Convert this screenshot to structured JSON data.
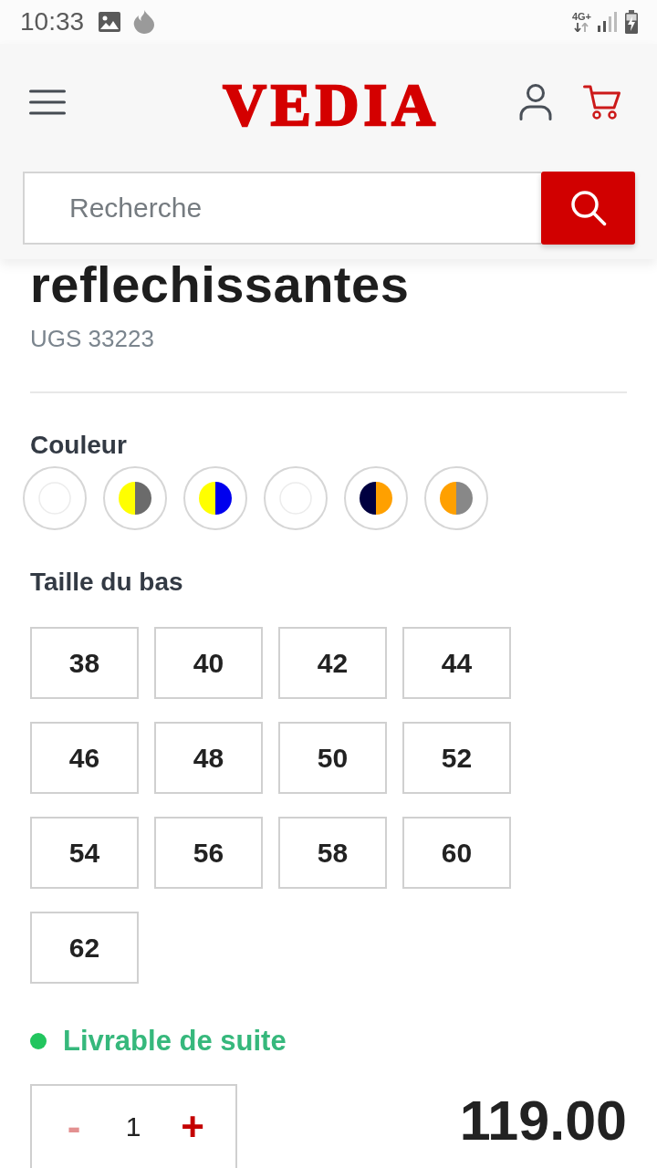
{
  "status_bar": {
    "time": "10:33",
    "network": "4G+"
  },
  "header": {
    "logo": "VEDIA",
    "search": {
      "placeholder": "Recherche"
    }
  },
  "product": {
    "title": "reflechissantes",
    "sku": "UGS 33223"
  },
  "color_option": {
    "label": "Couleur",
    "swatches": [
      {
        "tones": [
          {
            "color": "#ffffff"
          }
        ],
        "selected": false
      },
      {
        "tones": [
          {
            "color": "#ffff00"
          },
          {
            "color": "#6b6b6b"
          }
        ],
        "selected": false
      },
      {
        "tones": [
          {
            "color": "#ffff00"
          },
          {
            "color": "#0000ee"
          }
        ],
        "selected": false
      },
      {
        "tones": [
          {
            "color": "#ffffff"
          }
        ],
        "selected": false
      },
      {
        "tones": [
          {
            "color": "#000040"
          },
          {
            "color": "#ffa000"
          }
        ],
        "selected": false
      },
      {
        "tones": [
          {
            "color": "#ffa000"
          },
          {
            "color": "#888888"
          }
        ],
        "selected": false
      }
    ]
  },
  "size_option": {
    "label": "Taille du bas",
    "sizes": [
      {
        "label": "38",
        "selected": false
      },
      {
        "label": "40",
        "selected": false
      },
      {
        "label": "42",
        "selected": false
      },
      {
        "label": "44",
        "selected": false
      },
      {
        "label": "46",
        "selected": false
      },
      {
        "label": "48",
        "selected": false
      },
      {
        "label": "50",
        "selected": false
      },
      {
        "label": "52",
        "selected": false
      },
      {
        "label": "54",
        "selected": false
      },
      {
        "label": "56",
        "selected": false
      },
      {
        "label": "58",
        "selected": false
      },
      {
        "label": "60",
        "selected": false
      },
      {
        "label": "62",
        "selected": false
      }
    ]
  },
  "availability": {
    "text": "Livrable de suite",
    "in_stock": true
  },
  "quantity": {
    "minus": "-",
    "value": "1",
    "plus": "+",
    "minus_disabled": true
  },
  "price": "119.00"
}
